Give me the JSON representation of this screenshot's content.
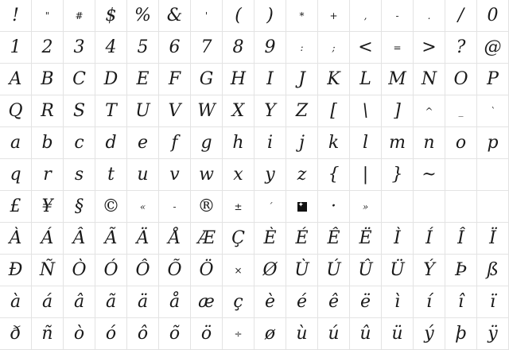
{
  "rows": [
    [
      "!",
      "\"",
      "#",
      "$",
      "%",
      "&",
      "'",
      "(",
      ")",
      "*",
      "+",
      ",",
      "-",
      ".",
      "/",
      "0"
    ],
    [
      "1",
      "2",
      "3",
      "4",
      "5",
      "6",
      "7",
      "8",
      "9",
      ":",
      ";",
      "<",
      "=",
      ">",
      "?",
      "@"
    ],
    [
      "A",
      "B",
      "C",
      "D",
      "E",
      "F",
      "G",
      "H",
      "I",
      "J",
      "K",
      "L",
      "M",
      "N",
      "O",
      "P"
    ],
    [
      "Q",
      "R",
      "S",
      "T",
      "U",
      "V",
      "W",
      "X",
      "Y",
      "Z",
      "[",
      "\\",
      "]",
      "^",
      "_",
      "`"
    ],
    [
      "a",
      "b",
      "c",
      "d",
      "e",
      "f",
      "g",
      "h",
      "i",
      "j",
      "k",
      "l",
      "m",
      "n",
      "o",
      "p"
    ],
    [
      "q",
      "r",
      "s",
      "t",
      "u",
      "v",
      "w",
      "x",
      "y",
      "z",
      "{",
      "|",
      "}",
      "~",
      "",
      ""
    ],
    [
      "£",
      "¥",
      "§",
      "©",
      "«",
      "-",
      "®",
      "±",
      "´",
      "¶",
      "·",
      "»",
      "",
      "",
      "",
      ""
    ],
    [
      "À",
      "Á",
      "Â",
      "Ã",
      "Ä",
      "Å",
      "Æ",
      "Ç",
      "È",
      "É",
      "Ê",
      "Ë",
      "Ì",
      "Í",
      "Î",
      "Ï"
    ],
    [
      "Ð",
      "Ñ",
      "Ò",
      "Ó",
      "Ô",
      "Õ",
      "Ö",
      "×",
      "Ø",
      "Ù",
      "Ú",
      "Û",
      "Ü",
      "Ý",
      "Þ",
      "ß"
    ],
    [
      "à",
      "á",
      "â",
      "ã",
      "ä",
      "å",
      "æ",
      "ç",
      "è",
      "é",
      "ê",
      "ë",
      "ì",
      "í",
      "î",
      "ï"
    ],
    [
      "ð",
      "ñ",
      "ò",
      "ó",
      "ô",
      "õ",
      "ö",
      "÷",
      "ø",
      "ù",
      "ú",
      "û",
      "ü",
      "ý",
      "þ",
      "ÿ"
    ]
  ]
}
